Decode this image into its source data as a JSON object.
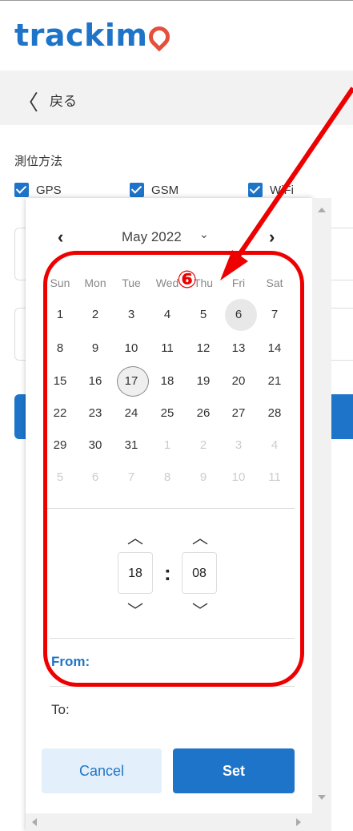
{
  "app": {
    "logo_text": "trackim",
    "brand_color": "#1e74c8",
    "accent_pin_color": "#e4503c"
  },
  "nav": {
    "back_label": "戻る"
  },
  "positioning": {
    "label": "測位方法",
    "options": [
      {
        "label": "GPS",
        "checked": true
      },
      {
        "label": "GSM",
        "checked": true
      },
      {
        "label": "WiFi",
        "checked": true
      }
    ]
  },
  "calendar": {
    "month_label": "May 2022",
    "weekdays": [
      "Sun",
      "Mon",
      "Tue",
      "Wed",
      "Thu",
      "Fri",
      "Sat"
    ],
    "weeks": [
      [
        {
          "d": "1"
        },
        {
          "d": "2"
        },
        {
          "d": "3"
        },
        {
          "d": "4"
        },
        {
          "d": "5"
        },
        {
          "d": "6",
          "highlight": "today"
        },
        {
          "d": "7"
        }
      ],
      [
        {
          "d": "8"
        },
        {
          "d": "9"
        },
        {
          "d": "10"
        },
        {
          "d": "11"
        },
        {
          "d": "12"
        },
        {
          "d": "13"
        },
        {
          "d": "14"
        }
      ],
      [
        {
          "d": "15"
        },
        {
          "d": "16"
        },
        {
          "d": "17",
          "highlight": "selected"
        },
        {
          "d": "18"
        },
        {
          "d": "19"
        },
        {
          "d": "20"
        },
        {
          "d": "21"
        }
      ],
      [
        {
          "d": "22"
        },
        {
          "d": "23"
        },
        {
          "d": "24"
        },
        {
          "d": "25"
        },
        {
          "d": "26"
        },
        {
          "d": "27"
        },
        {
          "d": "28"
        }
      ],
      [
        {
          "d": "29"
        },
        {
          "d": "30"
        },
        {
          "d": "31"
        },
        {
          "d": "1",
          "other": true
        },
        {
          "d": "2",
          "other": true
        },
        {
          "d": "3",
          "other": true
        },
        {
          "d": "4",
          "other": true
        }
      ],
      [
        {
          "d": "5",
          "other": true
        },
        {
          "d": "6",
          "other": true
        },
        {
          "d": "7",
          "other": true
        },
        {
          "d": "8",
          "other": true
        },
        {
          "d": "9",
          "other": true
        },
        {
          "d": "10",
          "other": true
        },
        {
          "d": "11",
          "other": true
        }
      ]
    ]
  },
  "time": {
    "hour": "18",
    "minute": "08"
  },
  "range": {
    "from_label": "From:",
    "to_label": "To:"
  },
  "buttons": {
    "cancel": "Cancel",
    "set": "Set"
  },
  "annotation": {
    "text": "⑥",
    "color": "#ee0000"
  }
}
